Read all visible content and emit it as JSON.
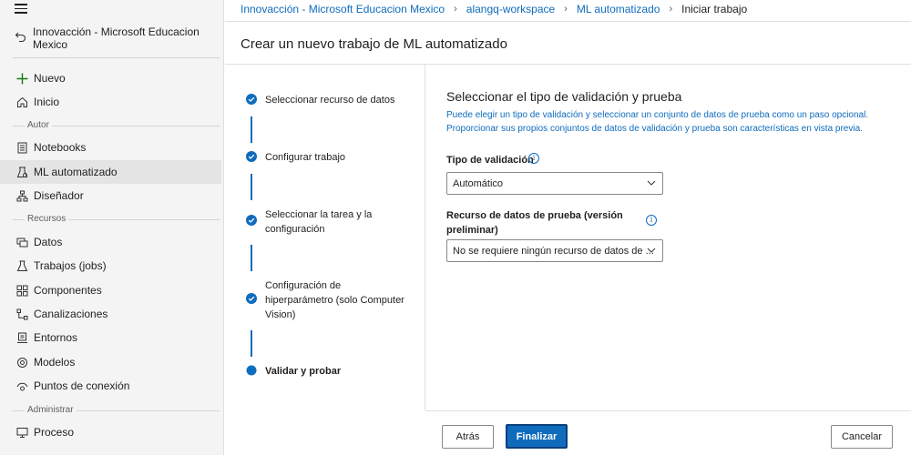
{
  "sidebar": {
    "workspace": "Innovacción - Microsoft Educacion Mexico",
    "new_label": "Nuevo",
    "home_label": "Inicio",
    "sections": {
      "author": "Autor",
      "assets": "Recursos",
      "manage": "Administrar"
    },
    "author_items": [
      {
        "label": "Notebooks",
        "icon": "notebook-icon"
      },
      {
        "label": "ML automatizado",
        "icon": "automl-icon",
        "selected": true
      },
      {
        "label": "Diseñador",
        "icon": "designer-icon"
      }
    ],
    "asset_items": [
      {
        "label": "Datos",
        "icon": "data-icon"
      },
      {
        "label": "Trabajos (jobs)",
        "icon": "jobs-icon"
      },
      {
        "label": "Componentes",
        "icon": "components-icon"
      },
      {
        "label": "Canalizaciones",
        "icon": "pipelines-icon"
      },
      {
        "label": "Entornos",
        "icon": "environments-icon"
      },
      {
        "label": "Modelos",
        "icon": "models-icon"
      },
      {
        "label": "Puntos de conexión",
        "icon": "endpoints-icon"
      }
    ],
    "manage_items": [
      {
        "label": "Proceso",
        "icon": "compute-icon"
      }
    ]
  },
  "breadcrumb": {
    "items": [
      "Innovacción - Microsoft Educacion Mexico",
      "alangq-workspace",
      "ML automatizado"
    ],
    "current": "Iniciar trabajo"
  },
  "page": {
    "title": "Crear un nuevo trabajo de ML automatizado"
  },
  "steps": [
    {
      "label": "Seleccionar recurso de datos",
      "status": "completed"
    },
    {
      "label": "Configurar trabajo",
      "status": "completed"
    },
    {
      "label": "Seleccionar la tarea y la configuración",
      "status": "completed"
    },
    {
      "label": "Configuración de hiperparámetro (solo Computer Vision)",
      "status": "completed"
    },
    {
      "label": "Validar y probar",
      "status": "current"
    }
  ],
  "panel": {
    "title": "Seleccionar el tipo de validación y prueba",
    "description": "Puede elegir un tipo de validación y seleccionar un conjunto de datos de prueba como un paso opcional. Proporcionar sus propios conjuntos de datos de validación y prueba son características en vista previa.",
    "validation_type": {
      "label": "Tipo de validación",
      "value": "Automático"
    },
    "test_data": {
      "label": "Recurso de datos de prueba (versión preliminar)",
      "value": "No se requiere ningún recurso de datos de ..."
    }
  },
  "footer": {
    "back_label": "Atrás",
    "finish_label": "Finalizar",
    "cancel_label": "Cancelar"
  },
  "colors": {
    "accent": "#0f6cbd",
    "sidebar_bg": "#f4f4f4",
    "selected_bg": "#e4e4e4"
  }
}
